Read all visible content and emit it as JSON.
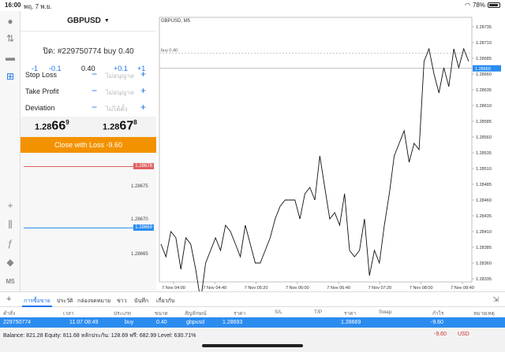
{
  "status": {
    "time": "16:00",
    "date": "พฤ. 7 พ.ย.",
    "battery": "78%"
  },
  "panel": {
    "symbol": "GBPUSD",
    "position": "ปิด: #229750774 buy 0.40",
    "volume": {
      "m1": "-1",
      "m01": "-0.1",
      "value": "0.40",
      "p01": "+0.1",
      "p1": "+1"
    },
    "stop_loss": {
      "label": "Stop Loss",
      "placeholder": "ไม่อนุญาต"
    },
    "take_profit": {
      "label": "Take Profit",
      "placeholder": "ไม่อนุญาต"
    },
    "deviation": {
      "label": "Deviation",
      "placeholder": "ไม่ได้ตั้ง"
    },
    "bid": {
      "pre": "1.28",
      "big": "66",
      "sup": "9"
    },
    "ask": {
      "pre": "1.28",
      "big": "67",
      "sup": "8"
    },
    "close_button": "Close with Loss -9.60",
    "depth": {
      "red_level": "1.28678",
      "blue_level": "1.28669",
      "labels": [
        "1.28675",
        "1.28670",
        "1.28665"
      ]
    }
  },
  "chart_data": {
    "type": "line",
    "title": "GBPUSD, M5",
    "order_label": "buy 0.40",
    "current_price": "1.28669",
    "yticks": [
      "1.28735",
      "1.28710",
      "1.28685",
      "1.28660",
      "1.28635",
      "1.28610",
      "1.28585",
      "1.28560",
      "1.28535",
      "1.28510",
      "1.28485",
      "1.28460",
      "1.28435",
      "1.28410",
      "1.28385",
      "1.28360",
      "1.28335"
    ],
    "xticks": [
      "7 Nov 04:00",
      "7 Nov 04:40",
      "7 Nov 05:20",
      "7 Nov 06:00",
      "7 Nov 06:40",
      "7 Nov 07:20",
      "7 Nov 08:00",
      "7 Nov 08:40"
    ],
    "ylim": [
      1.2833,
      1.2875
    ],
    "values": [
      1.2839,
      1.2837,
      1.2841,
      1.284,
      1.2835,
      1.284,
      1.2839,
      1.2835,
      1.283,
      1.2836,
      1.2838,
      1.284,
      1.2838,
      1.2842,
      1.2841,
      1.2839,
      1.2837,
      1.2842,
      1.2839,
      1.2836,
      1.2836,
      1.2838,
      1.284,
      1.2843,
      1.2845,
      1.2846,
      1.2846,
      1.2846,
      1.2843,
      1.2847,
      1.2848,
      1.2846,
      1.2853,
      1.2848,
      1.2843,
      1.2844,
      1.2842,
      1.2847,
      1.2838,
      1.2837,
      1.2838,
      1.2843,
      1.2834,
      1.2838,
      1.2836,
      1.2842,
      1.2847,
      1.2853,
      1.2855,
      1.2857,
      1.2852,
      1.2855,
      1.2854,
      1.2868,
      1.287,
      1.2866,
      1.2863,
      1.2867,
      1.2864,
      1.287,
      1.2867,
      1.287,
      1.2868
    ]
  },
  "tabs": [
    "การซื้อขาย",
    "ประวัติ",
    "กล่องจดหมาย",
    "ข่าว",
    "บันทึก",
    "เกี่ยวกับ"
  ],
  "table": {
    "headers": [
      "คำสั่ง",
      "เวลา",
      "ประเภท",
      "ขนาด",
      "สัญลักษณ์",
      "ราคา",
      "S/L",
      "T/P",
      "ราคา",
      "Swap",
      "กำไร",
      "หมายเหตุ"
    ],
    "row": [
      "229750774",
      "11.07 08:49",
      "buy",
      "0.40",
      "gbpusd",
      "1.28693",
      "",
      "",
      "1.28669",
      "",
      "-9.60",
      ""
    ]
  },
  "balance": {
    "text": "Balance: 821.28 Equity: 811.68 หลักประกัน: 128.69 ฟรี: 682.99 Level: 630.71%",
    "profit": "-9.60",
    "currency": "USD"
  }
}
